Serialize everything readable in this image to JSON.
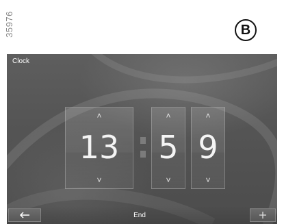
{
  "figure": {
    "ref_number": "35976",
    "badge": "B"
  },
  "screen": {
    "title": "Clock",
    "time": {
      "hours": "13",
      "minutes_tens": "5",
      "minutes_units": "9"
    },
    "arrows": {
      "up": "˄",
      "down": "˅"
    },
    "footer": {
      "back_icon": "arrow-left-icon",
      "center_label": "End",
      "right_icon": "plus-icon"
    }
  }
}
